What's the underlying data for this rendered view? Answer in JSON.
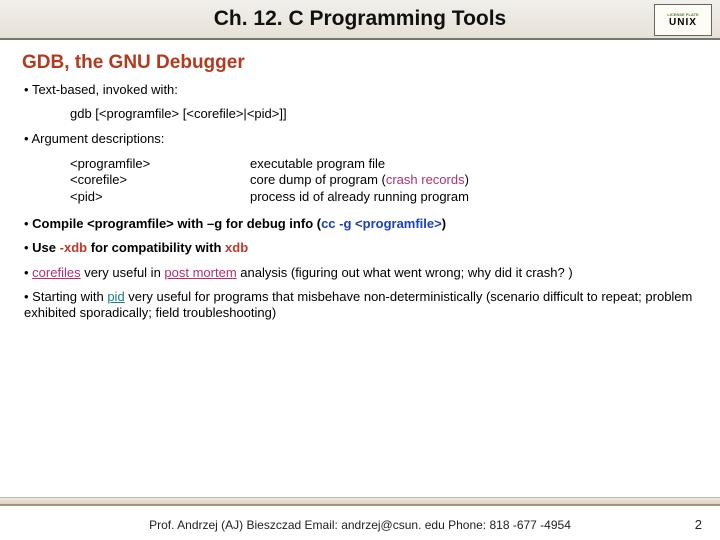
{
  "header": {
    "title": "Ch. 12. C Programming Tools",
    "logo_top": "LICENSE PLATE",
    "logo_main": "UNIX"
  },
  "subtitle": "GDB, the GNU Debugger",
  "bullets": {
    "b1": "Text-based, invoked with:",
    "cmd": "gdb [<programfile> [<corefile>|<pid>]]",
    "b2": "Argument descriptions:",
    "args": {
      "r1c1": "<programfile>",
      "r1c2": "executable program file",
      "r2c1": "<corefile>",
      "r2c2a": "core dump of program (",
      "r2c2b": "crash records",
      "r2c2c": ")",
      "r3c1": "<pid>",
      "r3c2": "process id of already running program"
    },
    "b3a": "Compile <programfile> with –g for debug info (",
    "b3b": "cc -g <programfile>",
    "b3c": ")",
    "b4a": "Use ",
    "b4b": "-xdb",
    "b4c": " for compatibility with ",
    "b4d": "xdb",
    "b5a": "corefiles",
    "b5b": " very useful in ",
    "b5c": "post mortem",
    "b5d": " analysis (figuring out what went wrong; why did it crash? )",
    "b6a": "Starting with ",
    "b6b": "pid",
    "b6c": " very useful for programs that misbehave non-deterministically (scenario difficult to repeat; problem exhibited sporadically; field troubleshooting)"
  },
  "footer": {
    "text": "Prof. Andrzej (AJ) Bieszczad Email: andrzej@csun. edu Phone: 818 -677 -4954",
    "page": "2"
  }
}
